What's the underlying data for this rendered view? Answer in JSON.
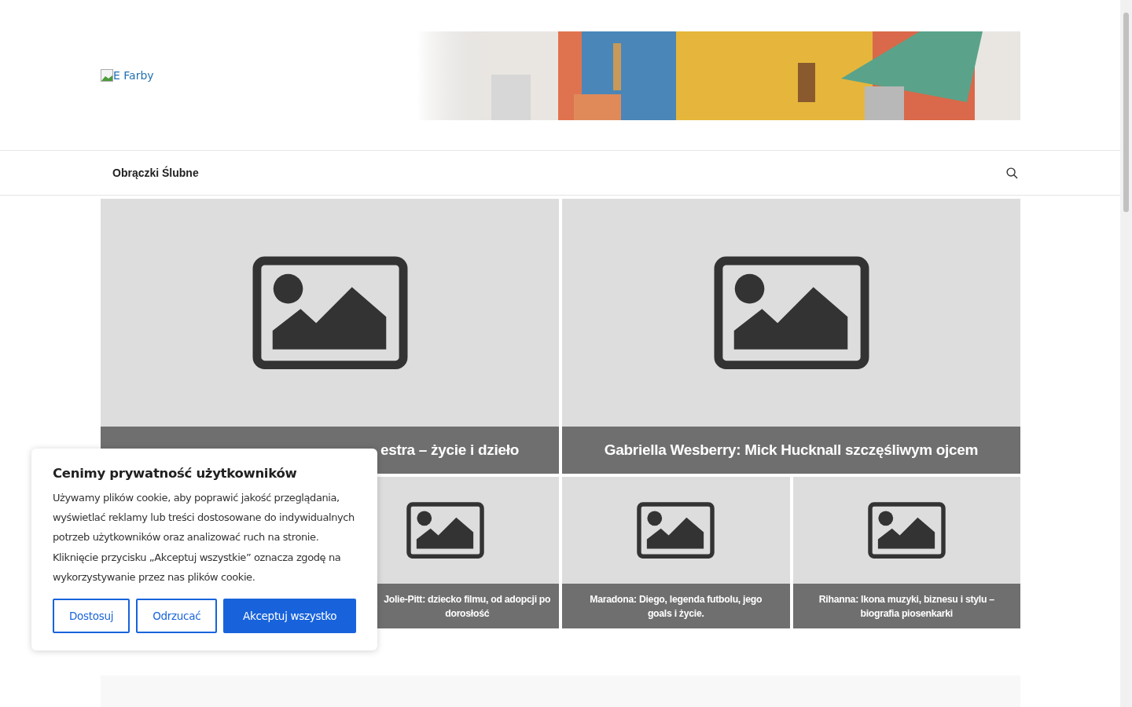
{
  "header": {
    "logo_alt": "E Farby"
  },
  "nav": {
    "items": [
      {
        "label": "Obrączki Ślubne"
      }
    ]
  },
  "featured": [
    {
      "title": "estra – życie i dzieło",
      "cut": true
    },
    {
      "title": "Gabriella Wesberry: Mick Hucknall szczęśliwym ojcem",
      "cut": false
    }
  ],
  "small_posts": [
    {
      "title": "Jolie-Pitt: dziecko filmu, od adopcji po dorosłość",
      "cut": true
    },
    {
      "title": "Maradona: Diego, legenda futbolu, jego goals i życie.",
      "cut": false
    },
    {
      "title": "Rihanna: Ikona muzyki, biznesu i stylu – biografia piosenkarki",
      "cut": false
    }
  ],
  "cookie_banner": {
    "title": "Cenimy prywatność użytkowników",
    "text": "Używamy plików cookie, aby poprawić jakość przeglądania, wyświetlać reklamy lub treści dostosowane do indywidualnych potrzeb użytkowników oraz analizować ruch na stronie. Kliknięcie przycisku „Akceptuj wszystkie” oznacza zgodę na wykorzystywanie przez nas plików cookie.",
    "buttons": [
      {
        "label": "Dostosuj",
        "kind": "outline"
      },
      {
        "label": "Odrzucać",
        "kind": "outline"
      },
      {
        "label": "Akceptuj wszystko",
        "kind": "primary"
      }
    ]
  }
}
